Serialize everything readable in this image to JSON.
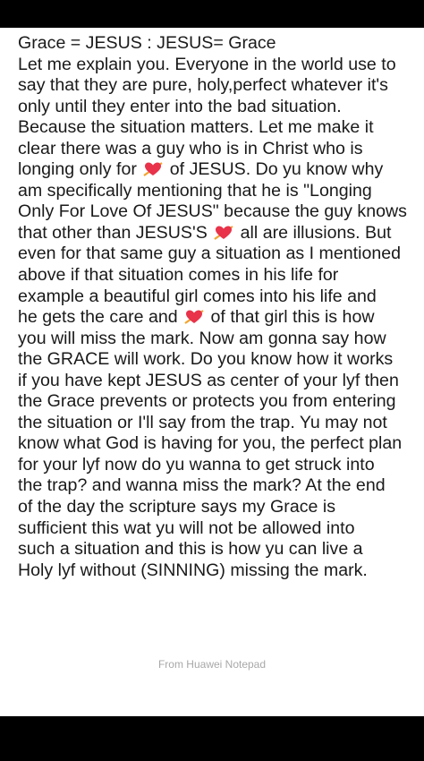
{
  "note": {
    "lines": [
      [
        "Grace = JESUS : JESUS= Grace"
      ],
      [
        "Let me explain you. Everyone in the world use to"
      ],
      [
        "say that they are pure, holy,perfect whatever it's"
      ],
      [
        "only until they enter into the bad situation."
      ],
      [
        "Because the situation matters. Let me make it"
      ],
      [
        "clear there was a guy who is in Christ who is"
      ],
      [
        "longing only for ",
        " of JESUS. Do yu know why"
      ],
      [
        "am specifically mentioning that he is \"Longing"
      ],
      [
        "Only For Love Of JESUS\" because the guy knows"
      ],
      [
        "that other than JESUS'S ",
        " all are illusions. But"
      ],
      [
        "even for that same guy a situation as I mentioned"
      ],
      [
        "above if that situation comes in his life for"
      ],
      [
        "example a beautiful girl comes into his life and"
      ],
      [
        "he gets the care and ",
        " of that girl this is how"
      ],
      [
        "you will miss the mark. Now am gonna say how"
      ],
      [
        "the GRACE will work. Do you know how it works"
      ],
      [
        "if you have kept JESUS as center of your lyf then"
      ],
      [
        "the Grace prevents or protects you from entering"
      ],
      [
        "the situation or I'll say from the trap. Yu may not"
      ],
      [
        "know what God is having for you, the perfect plan"
      ],
      [
        "for your lyf now do yu wanna to get struck into"
      ],
      [
        "the trap? and wanna miss the mark? At the end"
      ],
      [
        "of the day the scripture says my Grace is"
      ],
      [
        "sufficient this wat yu will not be allowed into"
      ],
      [
        "such a situation and this is how yu can live a"
      ],
      [
        "Holy lyf without (SINNING) missing the mark."
      ]
    ],
    "heart_icon": "heart-with-arrow-icon",
    "heart_color": "#e8334a",
    "arrow_color": "#f2a531",
    "footer": "From Huawei Notepad"
  }
}
